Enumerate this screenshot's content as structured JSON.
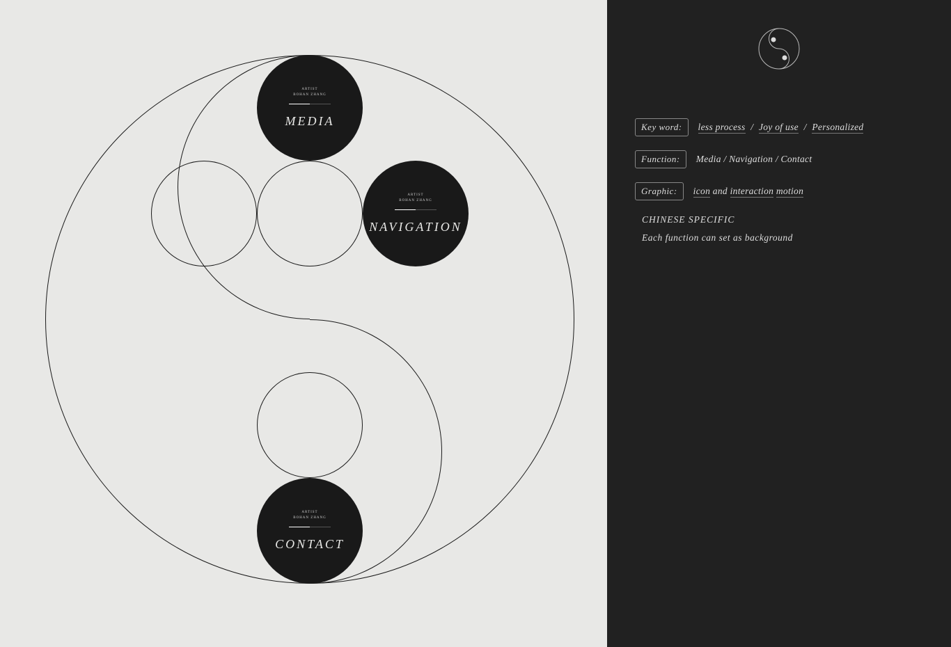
{
  "circles": {
    "media": {
      "top1": "ARTIST",
      "top2": "BOHAN ZHANG",
      "label": "MEDIA"
    },
    "navigation": {
      "top1": "ARTIST",
      "top2": "BOHAN ZHANG",
      "label": "NAVIGATION"
    },
    "contact": {
      "top1": "ARTIST",
      "top2": "BOHAN ZHANG",
      "label": "CONTACT"
    }
  },
  "sidebar": {
    "rows": {
      "keyword": {
        "badge": "Key word:",
        "v1": "less process",
        "v2": "Joy of use",
        "v3": "Personalized",
        "sep": "/"
      },
      "function": {
        "badge": "Function:",
        "value": "Media / Navigation / Contact"
      },
      "graphic": {
        "badge": "Graphic:",
        "v1": "icon",
        "mid": " and ",
        "v2": "interaction",
        "v3": "motion"
      }
    },
    "note1": "CHINESE SPECIFIC",
    "note2": "Each function can set as background"
  }
}
